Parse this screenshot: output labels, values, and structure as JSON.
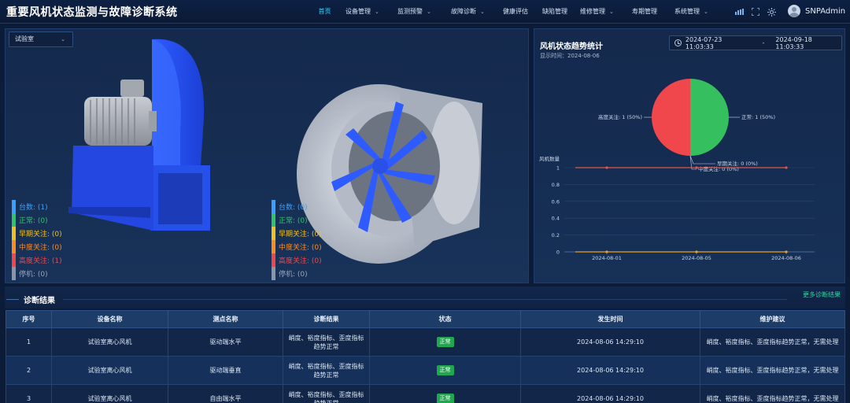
{
  "app": {
    "title": "重要风机状态监测与故障诊断系统"
  },
  "nav": {
    "items": [
      {
        "label": "首页",
        "dropdown": false
      },
      {
        "label": "设备管理",
        "dropdown": true
      },
      {
        "label": "监测预警",
        "dropdown": true
      },
      {
        "label": "故障诊断",
        "dropdown": true
      },
      {
        "label": "健康评估",
        "dropdown": false
      },
      {
        "label": "缺陷管理",
        "dropdown": false
      },
      {
        "label": "维修管理",
        "dropdown": true
      },
      {
        "label": "寿期管理",
        "dropdown": false
      },
      {
        "label": "系统管理",
        "dropdown": true
      }
    ],
    "active_index": 0
  },
  "user": {
    "name": "SNPAdmin"
  },
  "selector": {
    "value": "试验室"
  },
  "legend_left": [
    {
      "label": "台数: (1)",
      "color": "#3aa0ff"
    },
    {
      "label": "正常: (0)",
      "color": "#2fc46a"
    },
    {
      "label": "早期关注: (0)",
      "color": "#f0c020"
    },
    {
      "label": "中度关注: (0)",
      "color": "#ff8a1e"
    },
    {
      "label": "高度关注: (1)",
      "color": "#f0474c"
    },
    {
      "label": "停机: (0)",
      "color": "#8a96a8"
    }
  ],
  "legend_right": [
    {
      "label": "台数: (0)",
      "color": "#3aa0ff"
    },
    {
      "label": "正常: (0)",
      "color": "#2fc46a"
    },
    {
      "label": "早期关注: (0)",
      "color": "#f0c020"
    },
    {
      "label": "中度关注: (0)",
      "color": "#ff8a1e"
    },
    {
      "label": "高度关注: (0)",
      "color": "#f0474c"
    },
    {
      "label": "停机: (0)",
      "color": "#8a96a8"
    }
  ],
  "trend": {
    "title": "风机状态趋势统计",
    "subtitle": "显示时间：2024-08-06",
    "date_start": "2024-07-23 11:03:33",
    "date_sep": "-",
    "date_end": "2024-09-18 11:03:33"
  },
  "chart_data": [
    {
      "type": "pie",
      "slices": [
        {
          "label": "正常: 1 (50%)",
          "value": 1,
          "color": "#36bf5e"
        },
        {
          "label": "高度关注: 1 (50%)",
          "value": 1,
          "color": "#f0474c"
        },
        {
          "label": "早期关注: 0 (0%)",
          "value": 0,
          "color": "#f0c020"
        },
        {
          "label": "中度关注: 0 (0%)",
          "value": 0,
          "color": "#ff8a1e"
        }
      ]
    },
    {
      "type": "line",
      "ylabel": "风机数量",
      "x": [
        "2024-08-01",
        "2024-08-05",
        "2024-08-06"
      ],
      "y_ticks": [
        "0",
        "0.2",
        "0.4",
        "0.6",
        "0.8",
        "1"
      ],
      "ylim": [
        0,
        1
      ],
      "series": [
        {
          "values": [
            1,
            1,
            1
          ],
          "color": "#e8534a"
        },
        {
          "values": [
            0,
            0,
            0
          ],
          "color": "#f0a020"
        }
      ]
    }
  ],
  "diagnosis": {
    "title": "诊断结果",
    "more_link": "更多诊断结果",
    "columns": [
      "序号",
      "设备名称",
      "测点名称",
      "诊断结果",
      "状态",
      "发生时间",
      "维护建议"
    ],
    "rows": [
      {
        "no": "1",
        "device": "试验室离心风机",
        "point": "驱动端水平",
        "result": "峭度、裕度指标、歪度指标趋势正常",
        "status": "正常",
        "time": "2024-08-06 14:29:10",
        "advice": "峭度、裕度指标、歪度指标趋势正常，无需处理"
      },
      {
        "no": "2",
        "device": "试验室离心风机",
        "point": "驱动端垂直",
        "result": "峭度、裕度指标、歪度指标趋势正常",
        "status": "正常",
        "time": "2024-08-06 14:29:10",
        "advice": "峭度、裕度指标、歪度指标趋势正常，无需处理"
      },
      {
        "no": "3",
        "device": "试验室离心风机",
        "point": "自由端水平",
        "result": "峭度、裕度指标、歪度指标趋势正常",
        "status": "正常",
        "time": "2024-08-06 14:29:10",
        "advice": "峭度、裕度指标、歪度指标趋势正常，无需处理"
      }
    ]
  }
}
